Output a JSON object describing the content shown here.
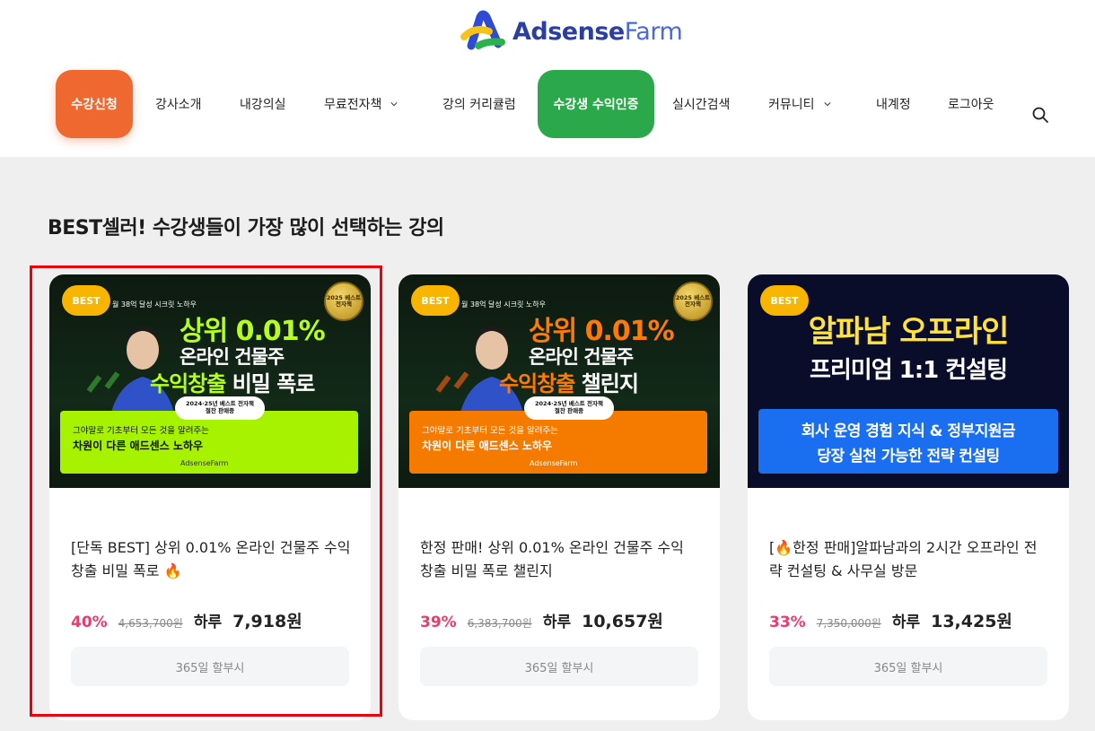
{
  "header": {
    "logo": {
      "part1": "Adsense",
      "part2": "Farm"
    },
    "nav": [
      {
        "label": "수강신청",
        "style": "orange"
      },
      {
        "label": "강사소개"
      },
      {
        "label": "내강의실"
      },
      {
        "label": "무료전자책",
        "dropdown": true
      },
      {
        "label": "강의 커리큘럼"
      },
      {
        "label": "수강생 수익인증",
        "style": "green"
      },
      {
        "label": "실시간검색"
      },
      {
        "label": "커뮤니티",
        "dropdown": true
      },
      {
        "label": "내계정"
      },
      {
        "label": "로그아웃"
      }
    ],
    "search_icon": "search-icon"
  },
  "section": {
    "title": "BEST셀러! 수강생들이 가장 많이 선택하는 강의"
  },
  "cards": [
    {
      "badge": "BEST",
      "thumb": {
        "top_text": "월 38억 달성 시크릿 노하우",
        "seal": "2025 베스트 전자책",
        "line1": "상위 0.01%",
        "line2": "온라인 건물주",
        "line3a": "수익창출",
        "line3b": "비밀 폭로",
        "pill1": "2024·25년 베스트 전자책",
        "pill2": "절찬 판매중",
        "band1": "그야말로 기초부터 모든 것을 알려주는",
        "band2": "차원이 다른 애드센스 노하우",
        "band_logo": "AdsenseFarm"
      },
      "title": "[단독 BEST] 상위 0.01% 온라인 건물주 수익 창출 비밀 폭로 🔥",
      "discount": "40%",
      "original_price": "4,653,700원",
      "per_day_label": "하루",
      "daily_price": "7,918원",
      "installment": "365일 할부시"
    },
    {
      "badge": "BEST",
      "thumb": {
        "top_text": "월 38억 달성 시크릿 노하우",
        "seal": "2025 베스트 전자책",
        "line1": "상위 0.01%",
        "line2": "온라인 건물주",
        "line3a": "수익창출",
        "line3b": "챌린지",
        "pill1": "2024·25년 베스트 전자책",
        "pill2": "절찬 판매중",
        "band1": "그야말로 기초부터 모든 것을 알려주는",
        "band2": "차원이 다른 애드센스 노하우",
        "band_logo": "AdsenseFarm"
      },
      "title": "한정 판매! 상위 0.01% 온라인 건물주 수익 창출 비밀 폭로 챌린지",
      "discount": "39%",
      "original_price": "6,383,700원",
      "per_day_label": "하루",
      "daily_price": "10,657원",
      "installment": "365일 할부시"
    },
    {
      "badge": "BEST",
      "thumb": {
        "line1": "알파남 오프라인",
        "line2": "프리미엄 1:1 컨설팅",
        "band1": "회사 운영 경험 지식 & 정부지원금",
        "band2": "당장 실천 가능한 전략 컨설팅"
      },
      "title": "[🔥한정 판매]알파남과의 2시간 오프라인 전략 컨설팅 & 사무실 방문",
      "discount": "33%",
      "original_price": "7,350,000원",
      "per_day_label": "하루",
      "daily_price": "13,425원",
      "installment": "365일 할부시"
    }
  ],
  "colors": {
    "accent_orange": "#ee6830",
    "accent_green": "#2aa84a",
    "discount_pink": "#f0386b",
    "highlight_red": "#e8000a"
  }
}
